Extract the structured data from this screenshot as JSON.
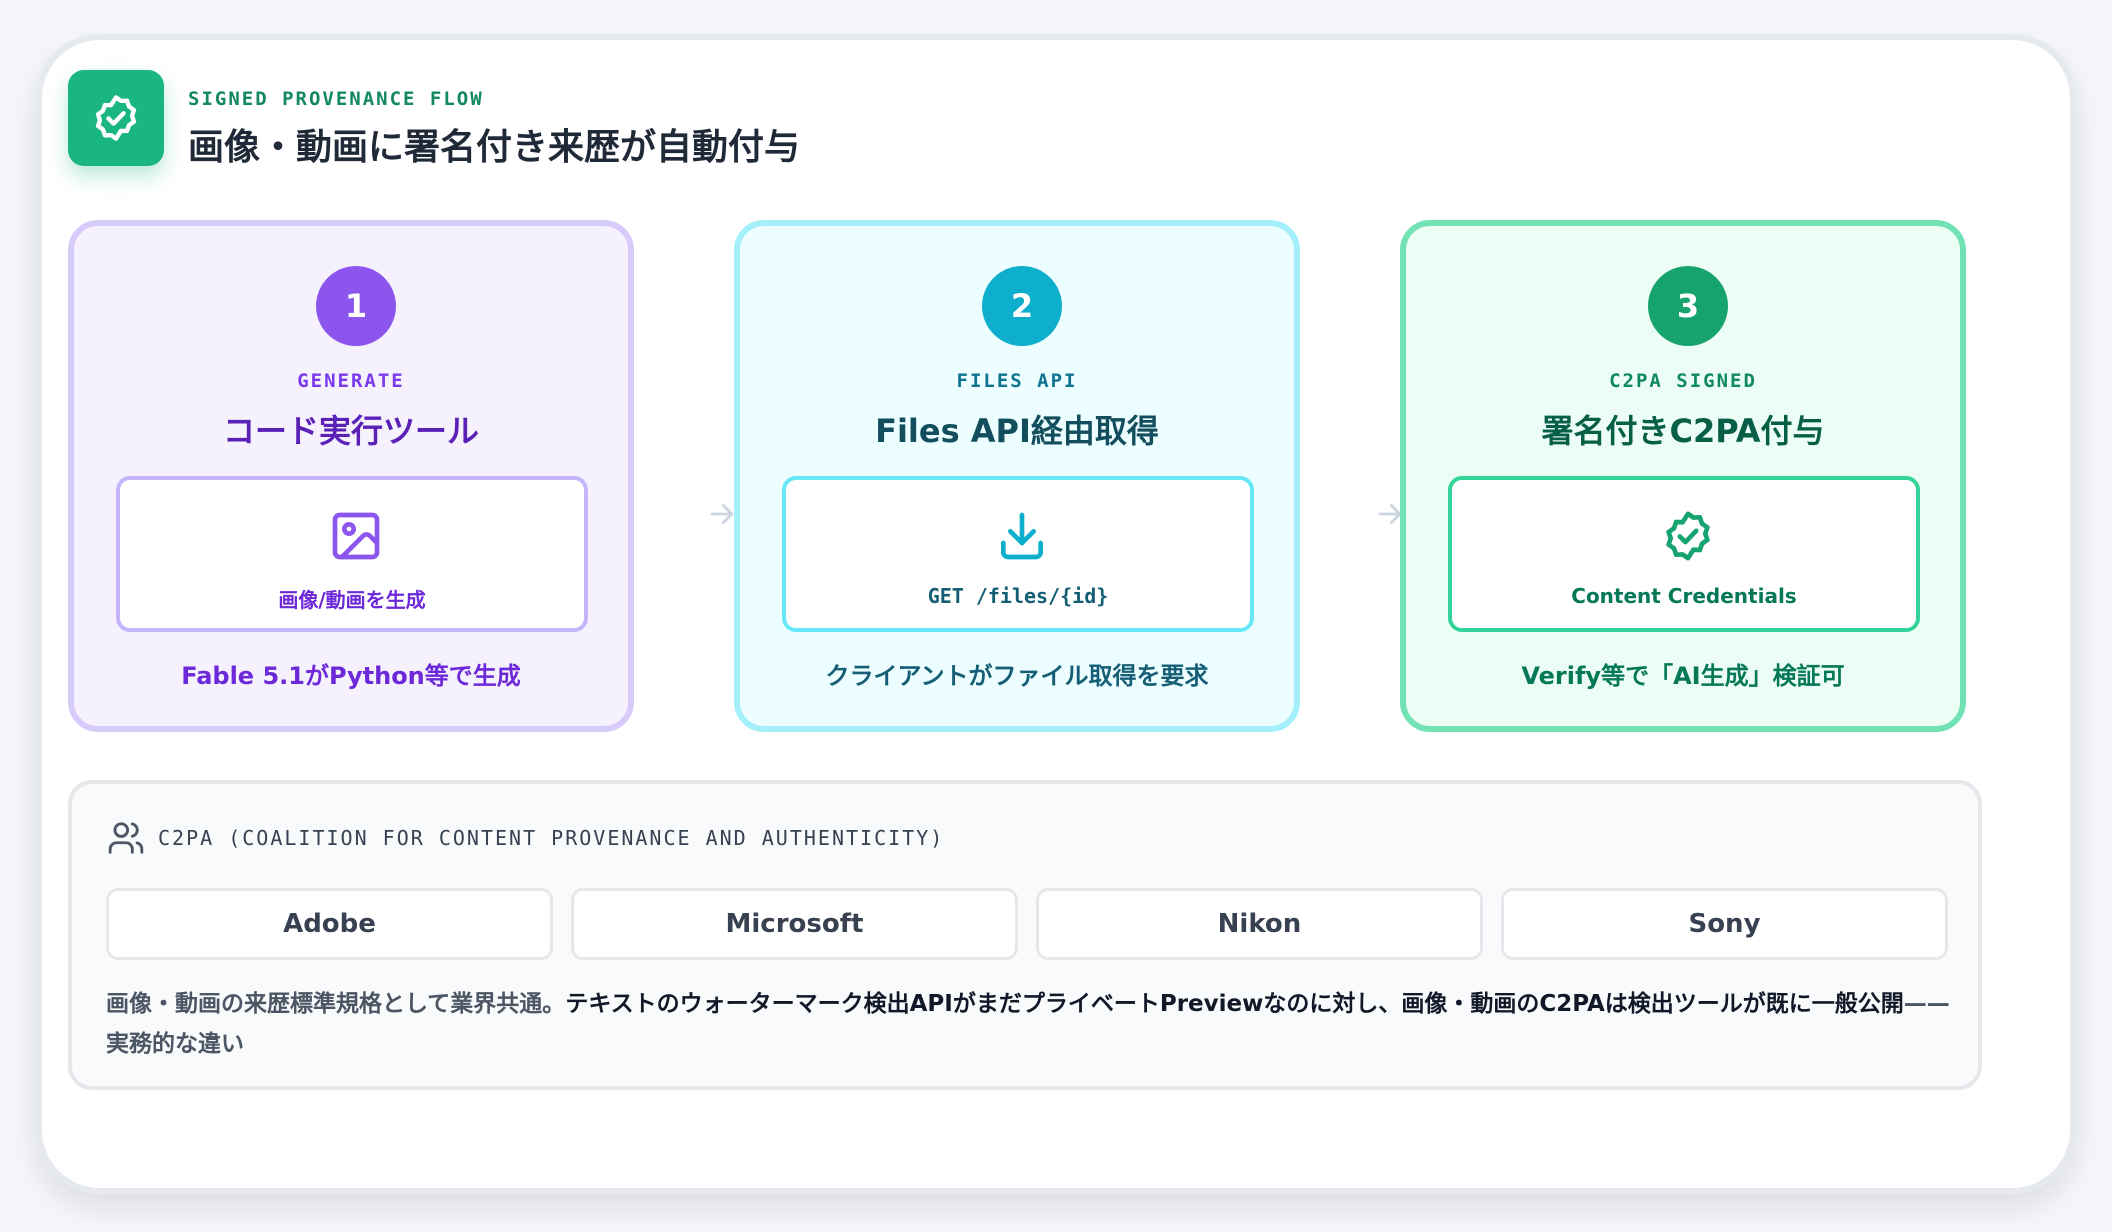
{
  "header": {
    "icon": "shield-check-icon",
    "eyebrow": "SIGNED PROVENANCE FLOW",
    "title": "画像・動画に署名付き来歴が自動付与"
  },
  "steps": [
    {
      "number": "1",
      "eyebrow": "GENERATE",
      "title": "コード実行ツール",
      "icon": "image-icon",
      "inner_label": "画像/動画を生成",
      "caption": "Fable 5.1がPython等で生成",
      "accent": "#8b55ee"
    },
    {
      "number": "2",
      "eyebrow": "FILES API",
      "title": "Files API経由取得",
      "icon": "download-icon",
      "inner_label": "GET /files/{id}",
      "caption": "クライアントがファイル取得を要求",
      "accent": "#0eaecd"
    },
    {
      "number": "3",
      "eyebrow": "C2PA SIGNED",
      "title": "署名付きC2PA付与",
      "icon": "badge-check-icon",
      "inner_label": "Content Credentials",
      "caption": "Verify等で「AI生成」検証可",
      "accent": "#17a370"
    }
  ],
  "c2pa": {
    "icon": "users-icon",
    "heading": "C2PA (COALITION FOR CONTENT PROVENANCE AND AUTHENTICITY)",
    "members": [
      "Adobe",
      "Microsoft",
      "Nikon",
      "Sony"
    ],
    "desc_lead": "画像・動画の来歴標準規格として業界共通。",
    "desc_strong": "テキストのウォーターマーク検出APIがまだプライベートPreviewなのに対し、画像・動画のC2PAは検出ツールが既に一般公開",
    "desc_tail": "——実務的な違い"
  }
}
